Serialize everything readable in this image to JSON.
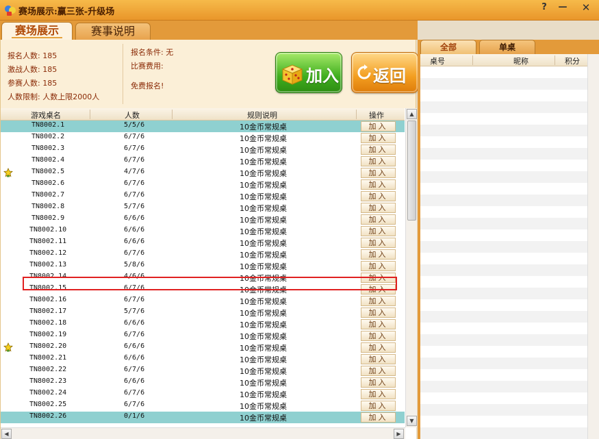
{
  "window": {
    "title": "赛场展示:赢三张-升级场",
    "help": "?",
    "minimize": "—",
    "close": "✕"
  },
  "tabs": [
    {
      "label": "赛场展示",
      "active": true
    },
    {
      "label": "赛事说明",
      "active": false
    }
  ],
  "info": {
    "registered": "报名人数: 185",
    "challengers": "激战人数: 185",
    "participants": "参赛人数: 185",
    "limit": "人数限制: 人数上限2000人",
    "condition": "报名条件: 无",
    "fee": "比赛费用:",
    "free": "免费报名!"
  },
  "buttons": {
    "join": "加入",
    "back": "返回"
  },
  "table": {
    "headers": {
      "name": "游戏桌名",
      "count": "人数",
      "rule": "规则说明",
      "action": "操作"
    },
    "join_label": "加入",
    "rows": [
      {
        "name": "TN8002.1",
        "count": "5/5/6",
        "rule": "10金币常规桌",
        "selected": true,
        "star": false
      },
      {
        "name": "TN8002.2",
        "count": "6/7/6",
        "rule": "10金币常规桌",
        "selected": false,
        "star": false
      },
      {
        "name": "TN8002.3",
        "count": "6/7/6",
        "rule": "10金币常规桌",
        "selected": false,
        "star": false
      },
      {
        "name": "TN8002.4",
        "count": "6/7/6",
        "rule": "10金币常规桌",
        "selected": false,
        "star": false
      },
      {
        "name": "TN8002.5",
        "count": "4/7/6",
        "rule": "10金币常规桌",
        "selected": false,
        "star": true
      },
      {
        "name": "TN8002.6",
        "count": "6/7/6",
        "rule": "10金币常规桌",
        "selected": false,
        "star": false
      },
      {
        "name": "TN8002.7",
        "count": "6/7/6",
        "rule": "10金币常规桌",
        "selected": false,
        "star": false
      },
      {
        "name": "TN8002.8",
        "count": "5/7/6",
        "rule": "10金币常规桌",
        "selected": false,
        "star": false
      },
      {
        "name": "TN8002.9",
        "count": "6/6/6",
        "rule": "10金币常规桌",
        "selected": false,
        "star": false
      },
      {
        "name": "TN8002.10",
        "count": "6/6/6",
        "rule": "10金币常规桌",
        "selected": false,
        "star": false
      },
      {
        "name": "TN8002.11",
        "count": "6/6/6",
        "rule": "10金币常规桌",
        "selected": false,
        "star": false
      },
      {
        "name": "TN8002.12",
        "count": "6/7/6",
        "rule": "10金币常规桌",
        "selected": false,
        "star": false
      },
      {
        "name": "TN8002.13",
        "count": "5/8/6",
        "rule": "10金币常规桌",
        "selected": false,
        "star": false
      },
      {
        "name": "TN8002.14",
        "count": "4/6/6",
        "rule": "10金币常规桌",
        "selected": false,
        "star": false
      },
      {
        "name": "TN8002.15",
        "count": "6/7/6",
        "rule": "10金币常规桌",
        "selected": false,
        "star": false
      },
      {
        "name": "TN8002.16",
        "count": "6/7/6",
        "rule": "10金币常规桌",
        "selected": false,
        "star": false
      },
      {
        "name": "TN8002.17",
        "count": "5/7/6",
        "rule": "10金币常规桌",
        "selected": false,
        "star": false
      },
      {
        "name": "TN8002.18",
        "count": "6/6/6",
        "rule": "10金币常规桌",
        "selected": false,
        "star": false
      },
      {
        "name": "TN8002.19",
        "count": "6/7/6",
        "rule": "10金币常规桌",
        "selected": false,
        "star": false
      },
      {
        "name": "TN8002.20",
        "count": "6/6/6",
        "rule": "10金币常规桌",
        "selected": false,
        "star": true
      },
      {
        "name": "TN8002.21",
        "count": "6/6/6",
        "rule": "10金币常规桌",
        "selected": false,
        "star": false
      },
      {
        "name": "TN8002.22",
        "count": "6/7/6",
        "rule": "10金币常规桌",
        "selected": false,
        "star": false
      },
      {
        "name": "TN8002.23",
        "count": "6/6/6",
        "rule": "10金币常规桌",
        "selected": false,
        "star": false
      },
      {
        "name": "TN8002.24",
        "count": "6/7/6",
        "rule": "10金币常规桌",
        "selected": false,
        "star": false
      },
      {
        "name": "TN8002.25",
        "count": "6/7/6",
        "rule": "10金币常规桌",
        "selected": false,
        "star": false
      },
      {
        "name": "TN8002.26",
        "count": "0/1/6",
        "rule": "10金币常规桌",
        "selected": true,
        "star": false
      }
    ]
  },
  "right_panel": {
    "tabs": [
      {
        "label": "全部",
        "active": true
      },
      {
        "label": "单桌",
        "active": false
      }
    ],
    "headers": {
      "table": "桌号",
      "nickname": "昵称",
      "score": "积分"
    }
  },
  "colors": {
    "title_bar": "#f0a83c",
    "selected_row": "#8fd0d0",
    "highlight_box": "#e02020",
    "join_green": "#3fae1e",
    "back_orange": "#f39e20"
  }
}
